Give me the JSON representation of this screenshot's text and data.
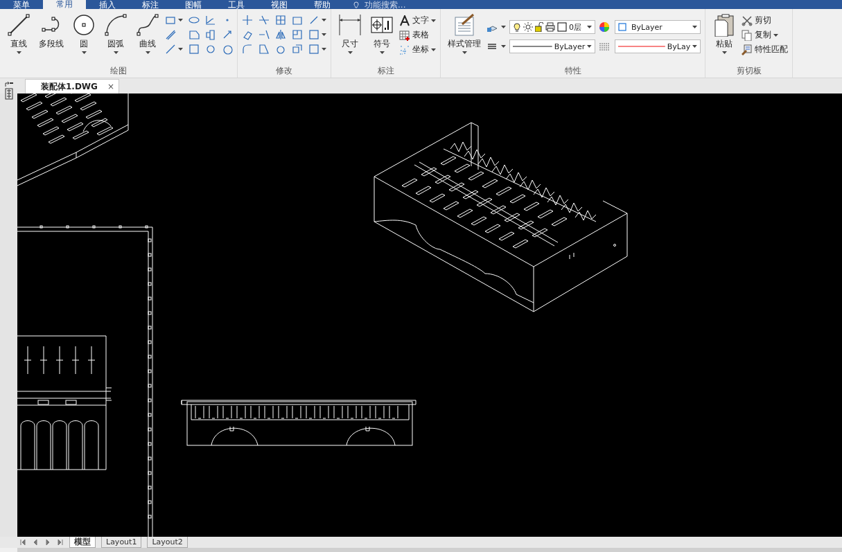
{
  "menu": {
    "items": [
      {
        "label": "菜单",
        "selected": false
      },
      {
        "label": "常用",
        "selected": true
      },
      {
        "label": "插入",
        "selected": false
      },
      {
        "label": "标注",
        "selected": false
      },
      {
        "label": "图幅",
        "selected": false
      },
      {
        "label": "工具",
        "selected": false
      },
      {
        "label": "视图",
        "selected": false
      },
      {
        "label": "帮助",
        "selected": false
      }
    ],
    "search": {
      "placeholder": "功能搜索..."
    }
  },
  "ribbon": {
    "panels": [
      {
        "title": "绘图",
        "large": [
          {
            "label": "直线",
            "dropdown": true
          },
          {
            "label": "多段线",
            "dropdown": false
          },
          {
            "label": "圆",
            "dropdown": true
          },
          {
            "label": "圆弧",
            "dropdown": true
          },
          {
            "label": "曲线",
            "dropdown": true
          }
        ]
      },
      {
        "title": "修改"
      },
      {
        "title": "标注",
        "large": [
          {
            "label": "尺寸",
            "dropdown": true
          },
          {
            "label": "符号",
            "dropdown": true
          }
        ],
        "small": [
          {
            "label": "文字",
            "dropdown": true
          },
          {
            "label": "表格",
            "dropdown": false
          },
          {
            "label": "坐标",
            "dropdown": true
          }
        ]
      },
      {
        "title": "特性",
        "large": [
          {
            "label": "样式管理",
            "dropdown": true
          }
        ],
        "combos": [
          {
            "kind": "layer",
            "value": "0层"
          },
          {
            "kind": "color",
            "value": "ByLayer"
          },
          {
            "kind": "linetype",
            "value": "ByLayer"
          },
          {
            "kind": "lineweight",
            "value": "ByLay"
          }
        ]
      },
      {
        "title": "剪切板",
        "large": [
          {
            "label": "粘贴",
            "dropdown": true
          }
        ],
        "small": [
          {
            "label": "剪切",
            "dropdown": false
          },
          {
            "label": "复制",
            "dropdown": true
          },
          {
            "label": "特性匹配",
            "dropdown": false
          }
        ]
      }
    ]
  },
  "document_tabs": [
    {
      "label": "装配体1.DWG",
      "selected": true,
      "close": "×"
    }
  ],
  "layout_tabs": [
    {
      "label": "模型",
      "selected": true
    },
    {
      "label": "Layout1",
      "selected": false
    },
    {
      "label": "Layout2",
      "selected": false
    }
  ]
}
